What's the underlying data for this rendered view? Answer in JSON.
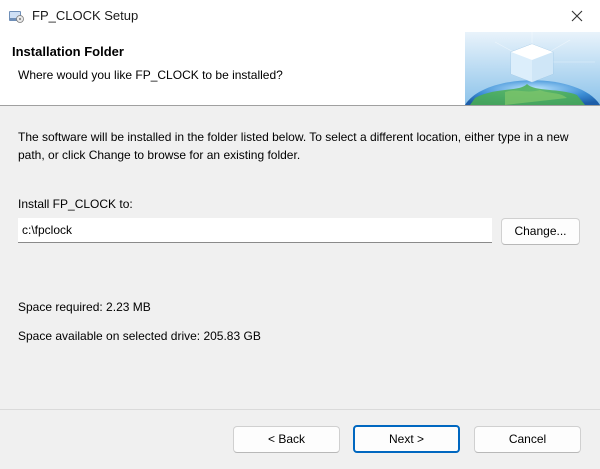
{
  "window": {
    "title": "FP_CLOCK Setup",
    "app_icon": "installer-icon",
    "close_icon": "close-icon"
  },
  "banner": {
    "title": "Installation Folder",
    "subtitle": "Where would you like FP_CLOCK to be installed?",
    "graphic": "globe-cube-graphic"
  },
  "body": {
    "description": "The software will be installed in the folder listed below. To select a different location, either type in a new path, or click Change to browse for an existing folder.",
    "install_label": "Install FP_CLOCK to:",
    "install_path": "c:\\fpclock",
    "change_button": "Change...",
    "space_required": "Space required: 2.23 MB",
    "space_available": "Space available on selected drive: 205.83 GB"
  },
  "footer": {
    "back_button": "< Back",
    "next_button": "Next >",
    "cancel_button": "Cancel"
  },
  "colors": {
    "accent": "#0067c0",
    "window_bg": "#f0f0f0",
    "banner_bg": "#ffffff"
  }
}
